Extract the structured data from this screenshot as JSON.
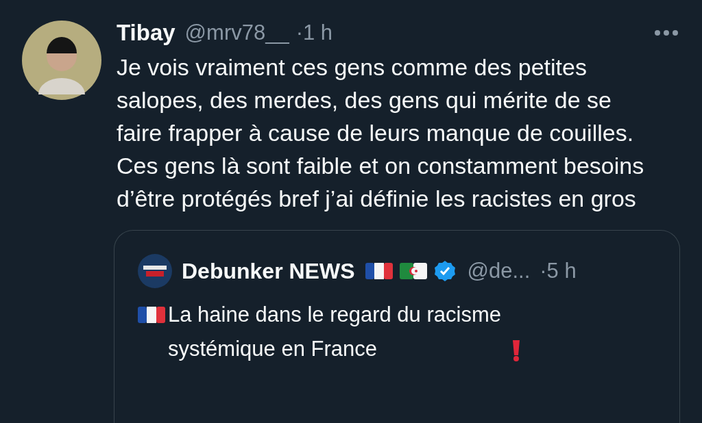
{
  "tweet": {
    "name": "Tibay",
    "handle": "@mrv78__",
    "time": "·1 h",
    "text": "Je vois vraiment ces gens comme des petites salopes, des merdes, des gens qui mérite de se faire frapper à cause de leurs manque de couilles. Ces gens là sont faible et on constamment besoins d’être protégés bref j’ai définie les racistes en gros",
    "quote": {
      "name": "Debunker NEWS",
      "verified": true,
      "handle": "@de...",
      "time": "·5 h",
      "text": "La haine dans le regard du racisme systémique en France"
    }
  }
}
